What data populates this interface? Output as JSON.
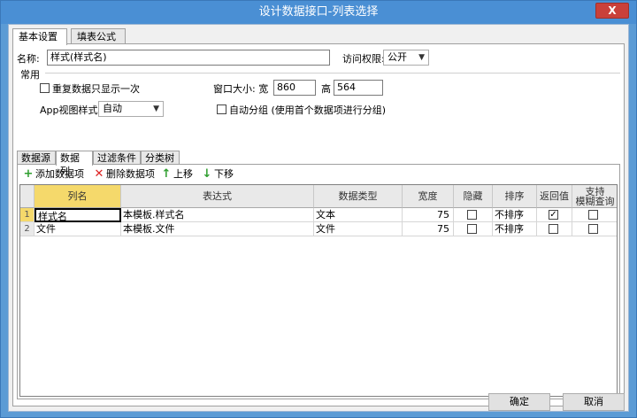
{
  "window": {
    "title": "设计数据接口-列表选择",
    "close_label": "X"
  },
  "top_tabs": [
    {
      "label": "基本设置"
    },
    {
      "label": "填表公式"
    }
  ],
  "form": {
    "name_label": "名称:",
    "name_value": "样式(样式名)",
    "access_label": "访问权限:",
    "access_value": "公开",
    "group_label": "常用",
    "repeat_once_label": "重复数据只显示一次",
    "window_size_label": "窗口大小: 宽",
    "width_value": "860",
    "height_label": "高",
    "height_value": "564",
    "app_view_label": "App视图样式",
    "app_view_value": "自动",
    "auto_group_label": "自动分组 (使用首个数据项进行分组)"
  },
  "inner_tabs": [
    {
      "label": "数据源"
    },
    {
      "label": "数据列"
    },
    {
      "label": "过滤条件"
    },
    {
      "label": "分类树"
    }
  ],
  "toolbar": {
    "add_label": "添加数据项",
    "delete_label": "删除数据项",
    "up_label": "上移",
    "down_label": "下移"
  },
  "grid": {
    "columns": [
      {
        "label": "列名"
      },
      {
        "label": "表达式"
      },
      {
        "label": "数据类型"
      },
      {
        "label": "宽度"
      },
      {
        "label": "隐藏"
      },
      {
        "label": "排序"
      },
      {
        "label": "返回值"
      },
      {
        "label_line1": "支持",
        "label_line2": "模糊查询"
      }
    ],
    "rows": [
      {
        "index": "1",
        "name": "样式名",
        "expr": "本模板.样式名",
        "type": "文本",
        "width": "75",
        "hidden": false,
        "sort": "不排序",
        "return": true,
        "fuzzy": false
      },
      {
        "index": "2",
        "name": "文件",
        "expr": "本模板.文件",
        "type": "文件",
        "width": "75",
        "hidden": false,
        "sort": "不排序",
        "return": false,
        "fuzzy": false
      }
    ]
  },
  "buttons": {
    "ok_label": "确定",
    "cancel_label": "取消"
  }
}
